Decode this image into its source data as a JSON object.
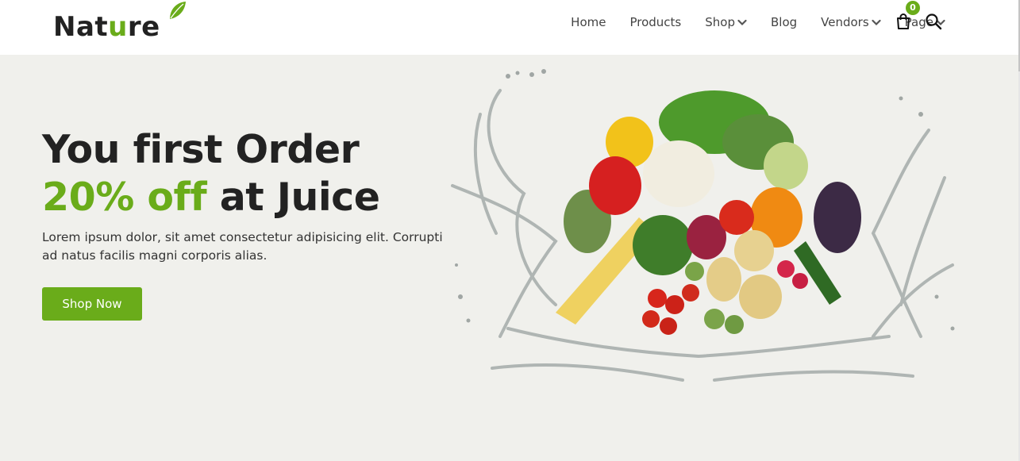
{
  "brand": {
    "name_start": "Nat",
    "name_accent": "u",
    "name_end": "re"
  },
  "nav": {
    "items": [
      {
        "label": "Home",
        "dropdown": false
      },
      {
        "label": "Products",
        "dropdown": false
      },
      {
        "label": "Shop",
        "dropdown": true
      },
      {
        "label": "Blog",
        "dropdown": false
      },
      {
        "label": "Vendors",
        "dropdown": true
      },
      {
        "label": "Page",
        "dropdown": true
      }
    ]
  },
  "cart": {
    "count": "0",
    "icon": "shopping-bag-icon"
  },
  "search": {
    "icon": "search-icon"
  },
  "hero": {
    "title_line1": "You first Order",
    "title_highlight": "20% off",
    "title_rest": "at Juice",
    "description": "Lorem ipsum dolor, sit amet consectetur adipisicing elit. Corrupti ad natus facilis magni corporis alias.",
    "cta_label": "Shop Now"
  },
  "colors": {
    "accent": "#6aac1a",
    "hero_bg": "#f0f0ec",
    "text": "#222222"
  }
}
